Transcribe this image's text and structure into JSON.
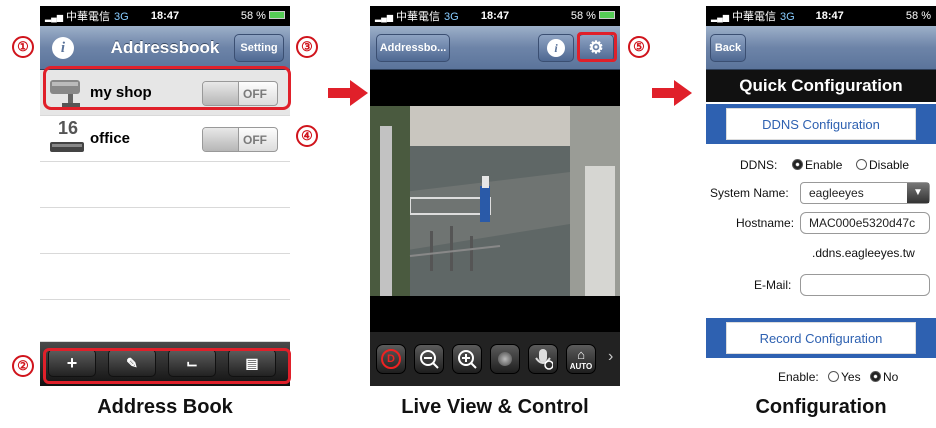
{
  "phone1": {
    "status": {
      "carrier": "中華電信",
      "network": "3G",
      "time": "18:47",
      "battery": "58 %"
    },
    "nav": {
      "info_label": "i",
      "title": "Addressbook",
      "setting_label": "Setting"
    },
    "rows": [
      {
        "name": "my shop",
        "toggle": "OFF"
      },
      {
        "name": "office",
        "toggle": "OFF",
        "badge": "16"
      }
    ],
    "toolbar": {
      "add": "+",
      "edit": "✎",
      "chart": "⌙",
      "print": "▤"
    }
  },
  "phone2": {
    "status": {
      "carrier": "中華電信",
      "network": "3G",
      "time": "18:47",
      "battery": "58 %"
    },
    "nav": {
      "back_label": "Addressbo...",
      "info_label": "i",
      "gear_label": "⚙"
    },
    "controls": {
      "rec": "D",
      "auto": "AUTO",
      "more": "›"
    }
  },
  "phone3": {
    "status": {
      "carrier": "中華電信",
      "network": "3G",
      "time": "18:47",
      "battery": "58 %"
    },
    "nav": {
      "back_label": "Back"
    },
    "title": "Quick Configuration",
    "ddns": {
      "header": "DDNS Configuration",
      "ddns_label": "DDNS:",
      "enable": "Enable",
      "disable": "Disable",
      "system_name_label": "System Name:",
      "system_name_value": "eagleeyes",
      "hostname_label": "Hostname:",
      "hostname_value": "MAC000e5320d47c",
      "domain_suffix": ".ddns.eagleeyes.tw",
      "email_label": "E-Mail:",
      "email_value": ""
    },
    "record": {
      "header": "Record Configuration",
      "enable_label": "Enable:",
      "yes": "Yes",
      "no": "No"
    }
  },
  "callouts": [
    "①",
    "②",
    "③",
    "④",
    "⑤"
  ],
  "captions": {
    "left": "Address Book",
    "middle": "Live View & Control",
    "right": "Configuration"
  },
  "colors": {
    "highlight": "#e0202a",
    "nav_blue": "#5b749b",
    "config_blue": "#2e61b1"
  }
}
